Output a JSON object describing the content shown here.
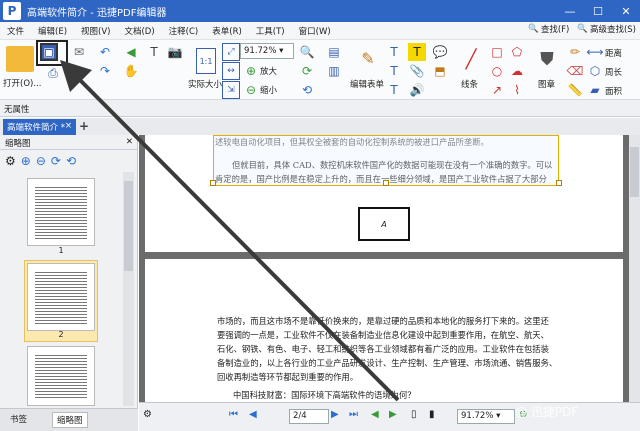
{
  "window": {
    "title": "高端软件简介 - 迅捷PDF编辑器",
    "app_icon": "P",
    "minimize": "—",
    "maximize": "☐",
    "close": "✕"
  },
  "menu": [
    "文件",
    "编辑(E)",
    "视图(V)",
    "文档(D)",
    "注释(C)",
    "表单(R)",
    "工具(T)",
    "窗口(W)"
  ],
  "menu_right": {
    "find": "查找(F)",
    "advanced_find": "高级查找(S)"
  },
  "toolbar": {
    "open_label": "打开(O)...",
    "actual_size_label": "实际大小",
    "zoom_value": "91.72%",
    "zoom_in_label": "放大",
    "zoom_out_label": "缩小",
    "edit_form_label": "编辑表单",
    "lines_label": "线条",
    "stamp_label": "图章",
    "distance_label": "距离",
    "perimeter_label": "周长",
    "area_label": "面积",
    "one_to_one": "1:1"
  },
  "properties_bar": {
    "label": "无属性"
  },
  "tabs": [
    {
      "label": "高端软件简介 *",
      "close": "×"
    }
  ],
  "tab_add": "+",
  "sidebar": {
    "title": "缩略图",
    "thumbnails": [
      {
        "number": "1"
      },
      {
        "number": "2"
      },
      {
        "number": ""
      }
    ]
  },
  "pane_tabs": [
    "书签",
    "缩略图"
  ],
  "document": {
    "page1_line1": "述较电自动化项目，但其权全被套的自动化控制系统的被进口产品所垄断。",
    "page1_para1": "但就目前，具体 CAD、数控机床软件国产化的数据可能现在没有一个准确的数字。可以",
    "page1_para2": "肯定的是，国产比例是在稳定上升的，而且在一些细分领域，是国产工业软件占据了大部分",
    "page1_box": "A",
    "page2_lines": [
      "市场的，而且这市场不是靠低价换来的，是靠过硬的品质和本地化的服务打下来的。这里还",
      "要强调的一点是，工业软件不仅在装备制造业信息化建设中起到重要作用，在航空、航天、",
      "石化、钢铁、有色、电子、轻工和纺织等各工业领域都有着广泛的应用。工业软件在包括装",
      "备制造业的，以上各行业的工业产品研发设计、生产控制、生产管理、市场流通、销售服务、",
      "回收再制造等环节都起到重要的作用。"
    ],
    "page2_heading": "中国科技财富：国际环境下高端软件的语境为何？"
  },
  "statusbar": {
    "page": "2/4",
    "zoom": "91.72%"
  },
  "watermark": "@ 迅捷PDF"
}
